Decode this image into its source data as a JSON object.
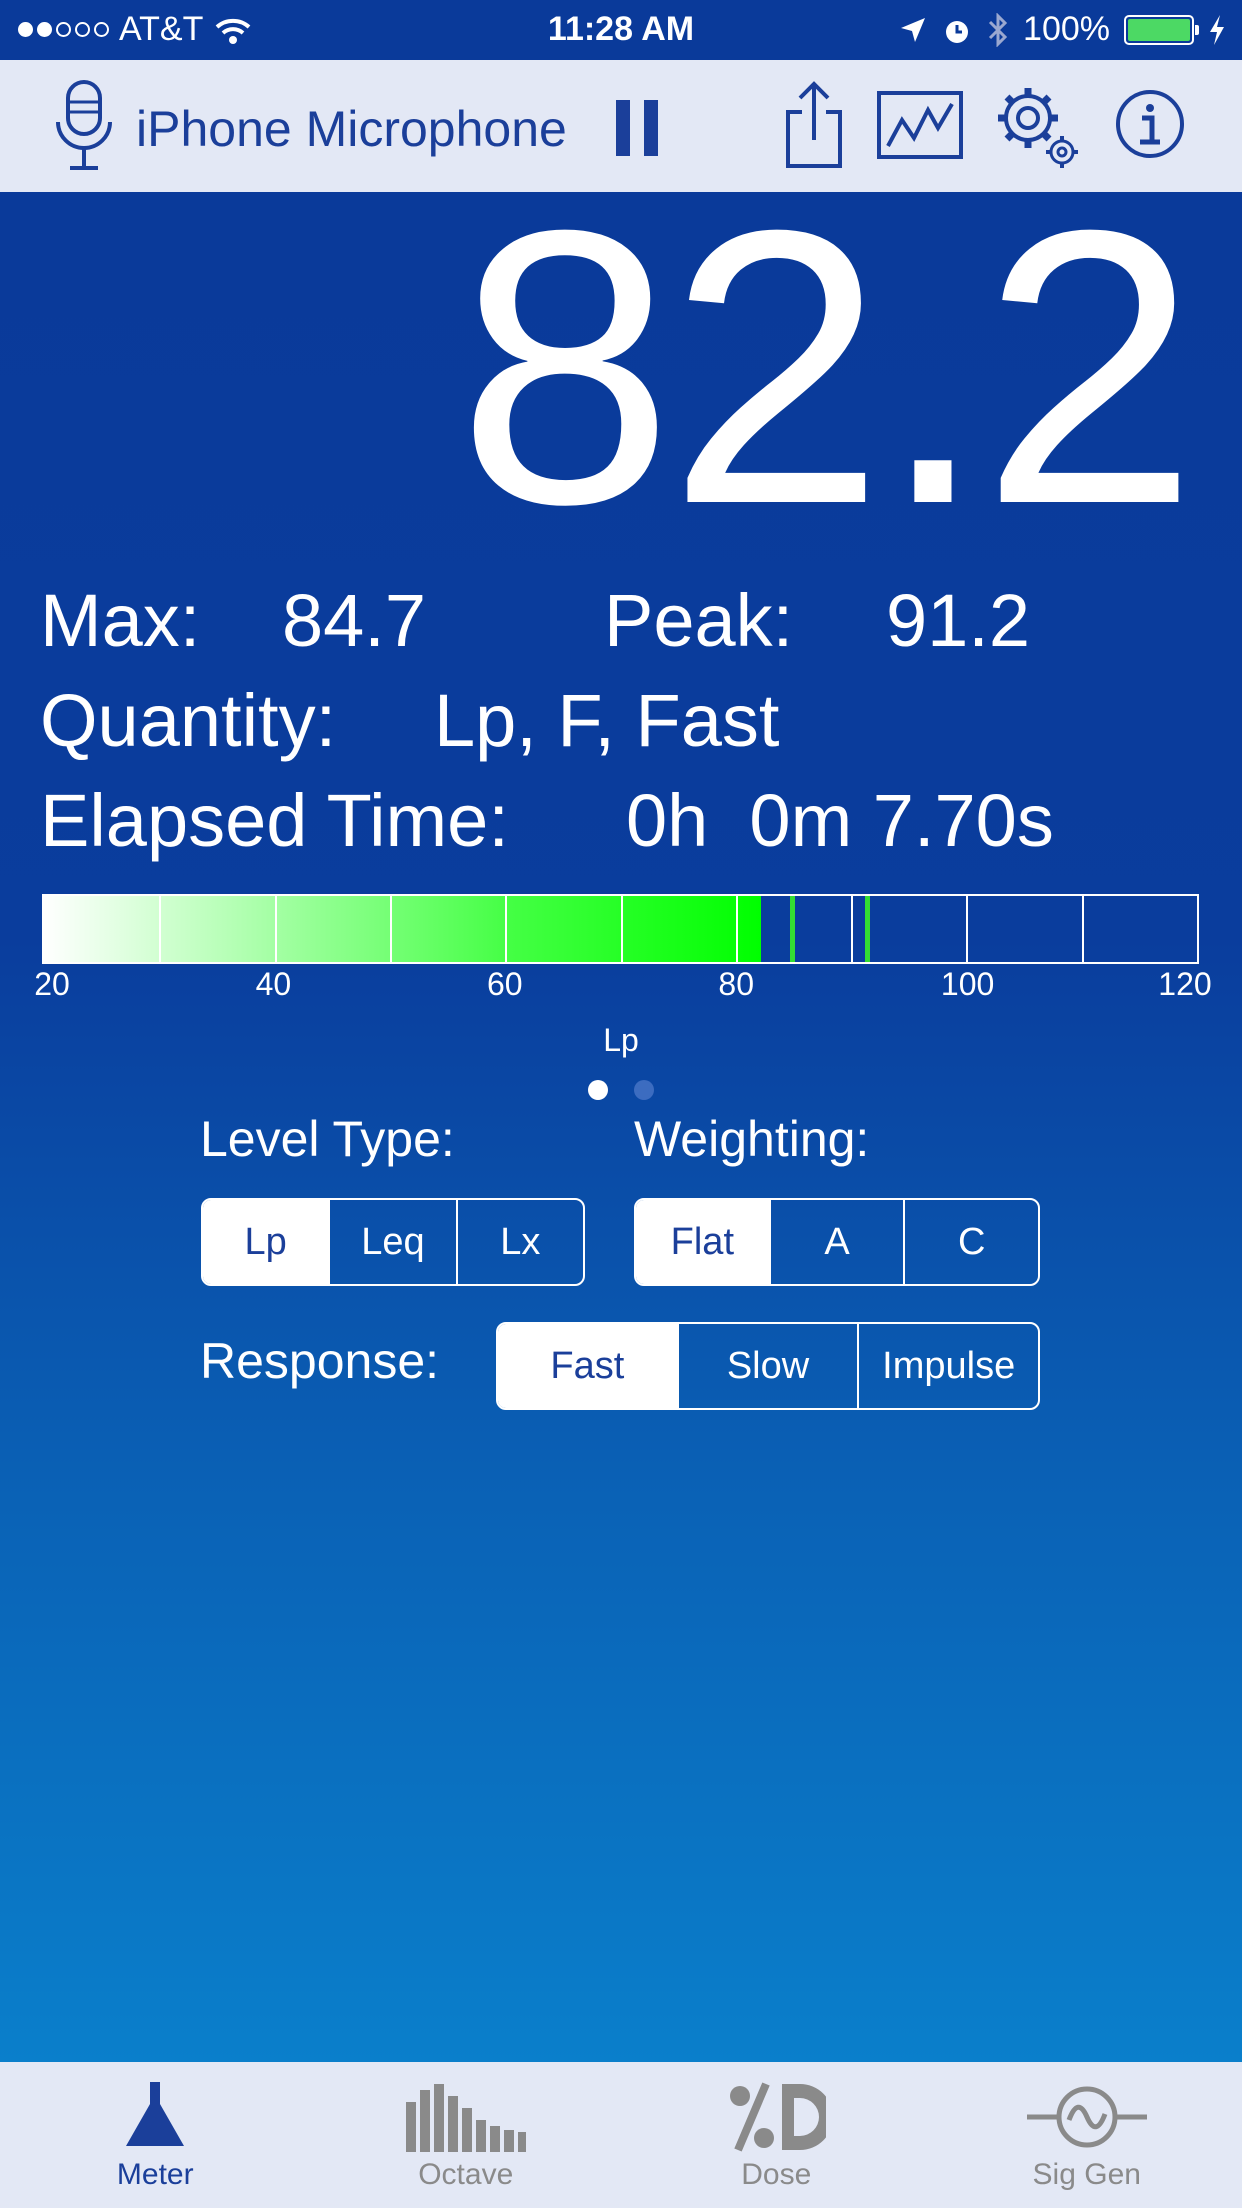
{
  "status_bar": {
    "carrier": "AT&T",
    "time": "11:28 AM",
    "battery": "100%",
    "battery_level": 1.0,
    "signal_bars": 2
  },
  "toolbar": {
    "source": "iPhone Microphone",
    "icons": [
      "microphone-icon",
      "pause-icon",
      "share-icon",
      "chart-icon",
      "settings-icon",
      "info-icon"
    ]
  },
  "readout": {
    "value": "82.2",
    "max_label": "Max:",
    "max_value": "84.7",
    "peak_label": "Peak:",
    "peak_value": "91.2",
    "quantity_label": "Quantity:",
    "quantity_value": "Lp, F, Fast",
    "elapsed_label": "Elapsed Time:",
    "elapsed_value": "0h  0m 7.70s"
  },
  "meter": {
    "min": 20,
    "max": 120,
    "level": 82.2,
    "max_marker": 84.7,
    "peak_marker": 91.2,
    "ticks": [
      "20",
      "40",
      "60",
      "80",
      "100",
      "120"
    ],
    "unit": "Lp"
  },
  "pages": {
    "count": 2,
    "current": 0
  },
  "controls": {
    "level_type": {
      "label": "Level Type:",
      "options": [
        "Lp",
        "Leq",
        "Lx"
      ],
      "selected": "Lp"
    },
    "weighting": {
      "label": "Weighting:",
      "options": [
        "Flat",
        "A",
        "C"
      ],
      "selected": "Flat"
    },
    "response": {
      "label": "Response:",
      "options": [
        "Fast",
        "Slow",
        "Impulse"
      ],
      "selected": "Fast"
    }
  },
  "tabs": [
    {
      "label": "Meter",
      "icon": "meter-icon",
      "active": true
    },
    {
      "label": "Octave",
      "icon": "octave-icon",
      "active": false
    },
    {
      "label": "Dose",
      "icon": "dose-icon",
      "active": false
    },
    {
      "label": "Sig Gen",
      "icon": "sig-gen-icon",
      "active": false
    }
  ],
  "colors": {
    "background": "#0a3a9a",
    "accent": "#1b3f9a",
    "meter_fill": "#00ff00",
    "bars_light": "#e3e8f5"
  }
}
